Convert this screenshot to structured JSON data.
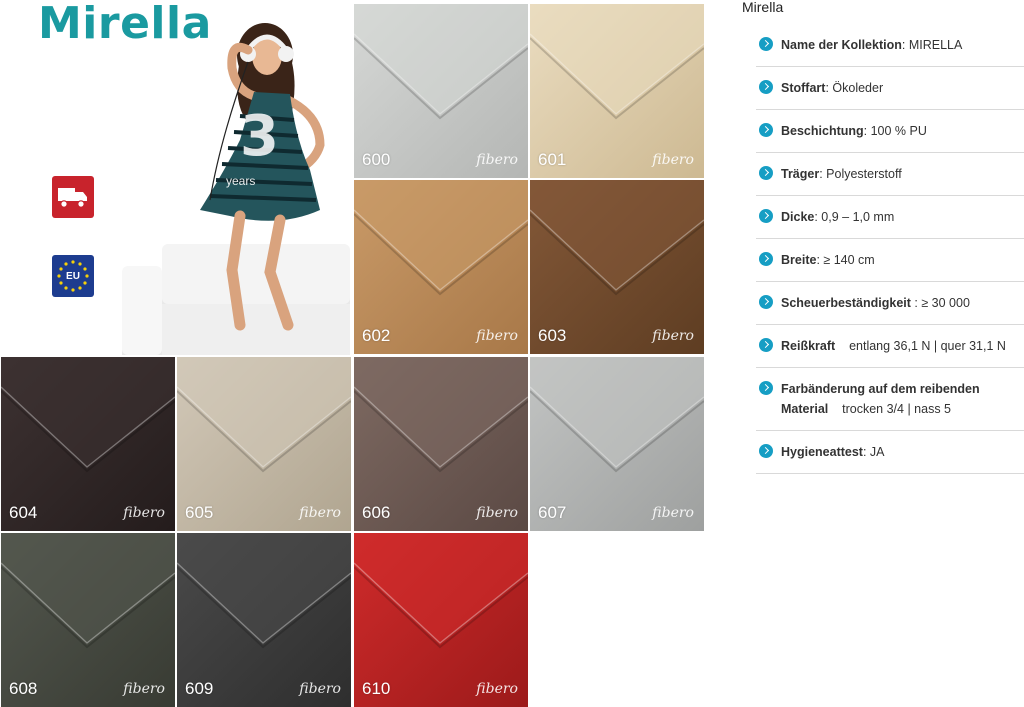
{
  "hero": {
    "brand": "Mirella",
    "warranty_number": "3",
    "warranty_word": "years",
    "eu_badge": "EU"
  },
  "swatches": [
    {
      "code": "600",
      "logo": "fibero",
      "color_light": "#d6d8d6",
      "color_dark": "#b4b6b4"
    },
    {
      "code": "601",
      "logo": "fibero",
      "color_light": "#eadcc0",
      "color_dark": "#cdb992"
    },
    {
      "code": "602",
      "logo": "fibero",
      "color_light": "#c99a68",
      "color_dark": "#a87848"
    },
    {
      "code": "603",
      "logo": "fibero",
      "color_light": "#835838",
      "color_dark": "#5e3d22"
    },
    {
      "code": "604",
      "logo": "fibero",
      "color_light": "#3d3232",
      "color_dark": "#241c1c"
    },
    {
      "code": "605",
      "logo": "fibero",
      "color_light": "#d2c8b8",
      "color_dark": "#b0a590"
    },
    {
      "code": "606",
      "logo": "fibero",
      "color_light": "#7e6a62",
      "color_dark": "#5b4944"
    },
    {
      "code": "607",
      "logo": "fibero",
      "color_light": "#c2c4c3",
      "color_dark": "#9ea09f"
    },
    {
      "code": "608",
      "logo": "fibero",
      "color_light": "#53574e",
      "color_dark": "#383b33"
    },
    {
      "code": "609",
      "logo": "fibero",
      "color_light": "#4a4a4a",
      "color_dark": "#2e2e2e"
    },
    {
      "code": "610",
      "logo": "fibero",
      "color_light": "#cf2b2b",
      "color_dark": "#9c1a1a"
    }
  ],
  "panel": {
    "title": "Mirella",
    "specs": [
      {
        "label": "Name der Kollektion",
        "value": ": MIRELLA"
      },
      {
        "label": "Stoffart",
        "value": ": Ökoleder"
      },
      {
        "label": "Beschichtung",
        "value": ": 100 % PU"
      },
      {
        "label": "Träger",
        "value": ": Polyesterstoff"
      },
      {
        "label": "Dicke",
        "value": ": 0,9 – 1,0 mm"
      },
      {
        "label": "Breite",
        "value": ": ≥ 140 cm"
      },
      {
        "label": "Scheuerbeständigkeit",
        "value": " : ≥ 30 000"
      },
      {
        "label": "Reißkraft",
        "value": "    entlang 36,1 N | quer 31,1 N"
      },
      {
        "label": "Farbänderung auf dem reibenden Material",
        "value": "    trocken 3/4 | nass 5"
      },
      {
        "label": "Hygieneattest",
        "value": ": JA"
      }
    ]
  },
  "colors": {
    "brand_teal": "#1a9aa0",
    "bullet_blue": "#169ec4",
    "badge_red": "#c8232c",
    "badge_blue": "#1d3c8f"
  }
}
